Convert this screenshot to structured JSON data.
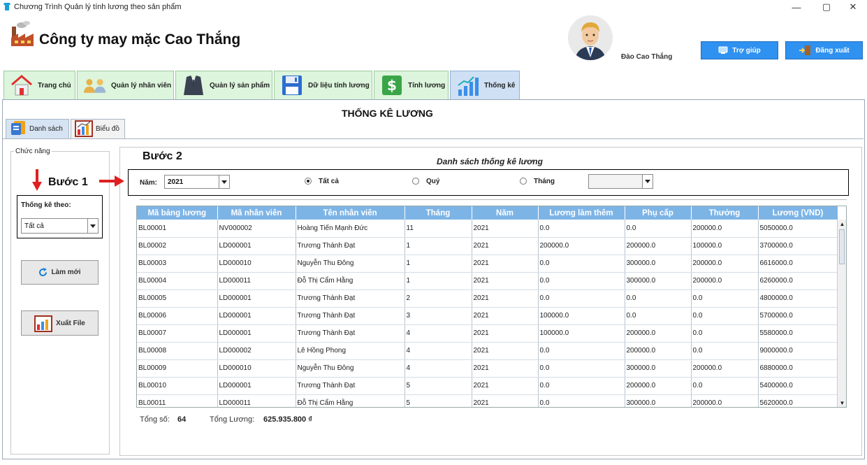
{
  "window": {
    "title": "Chương Trình Quản lý tính lương theo sản phẩm",
    "minimize_glyph": "—",
    "maximize_glyph": "▢",
    "close_glyph": "✕"
  },
  "header": {
    "company_name": "Công ty may mặc Cao Thắng",
    "user_name": "Đào Cao Thắng",
    "help_label": "Trợ giúp",
    "logout_label": "Đăng xuất"
  },
  "tabs": [
    {
      "label": "Trang chủ",
      "icon": "house-icon"
    },
    {
      "label": "Quản lý nhân viên",
      "icon": "people-icon"
    },
    {
      "label": "Quản lý sản phẩm",
      "icon": "suit-icon"
    },
    {
      "label": "Dữ liệu tính lương",
      "icon": "floppy-icon"
    },
    {
      "label": "Tính lương",
      "icon": "dollar-icon"
    },
    {
      "label": "Thống kê",
      "icon": "bar-chart-icon"
    }
  ],
  "page_title": "THỐNG KÊ LƯƠNG",
  "subtabs": [
    {
      "label": "Danh sách",
      "icon": "document-icon"
    },
    {
      "label": "Biểu đồ",
      "icon": "chart-icon"
    }
  ],
  "function_panel": {
    "title": "Chức năng",
    "step_label": "Bước 1",
    "stat_by_label": "Thống kê theo:",
    "stat_by_value": "Tất cả",
    "refresh_label": "Làm mới",
    "export_label": "Xuất File"
  },
  "list": {
    "step_label": "Bước 2",
    "title": "Danh sách thống kê lương",
    "year_label": "Năm:",
    "year_value": "2021",
    "radio_all": "Tất cả",
    "radio_quarter": "Quý",
    "radio_month": "Tháng",
    "month_value": ""
  },
  "table": {
    "columns": [
      "Mã bảng lương",
      "Mã nhân viên",
      "Tên nhân viên",
      "Tháng",
      "Năm",
      "Lương làm thêm",
      "Phụ cấp",
      "Thưởng",
      "Lương (VND)"
    ],
    "rows": [
      [
        "BL00001",
        "NV000002",
        "Hoàng Tiến Mạnh Đức",
        "11",
        "2021",
        "0.0",
        "0.0",
        "200000.0",
        "5050000.0"
      ],
      [
        "BL00002",
        "LD000001",
        "Trương Thành Đạt",
        "1",
        "2021",
        "200000.0",
        "200000.0",
        "100000.0",
        "3700000.0"
      ],
      [
        "BL00003",
        "LD000010",
        "Nguyễn Thu Đông",
        "1",
        "2021",
        "0.0",
        "300000.0",
        "200000.0",
        "6616000.0"
      ],
      [
        "BL00004",
        "LD000011",
        "Đỗ Thị Cẩm Hằng",
        "1",
        "2021",
        "0.0",
        "300000.0",
        "200000.0",
        "6260000.0"
      ],
      [
        "BL00005",
        "LD000001",
        "Trương Thành Đạt",
        "2",
        "2021",
        "0.0",
        "0.0",
        "0.0",
        "4800000.0"
      ],
      [
        "BL00006",
        "LD000001",
        "Trương Thành Đạt",
        "3",
        "2021",
        "100000.0",
        "0.0",
        "0.0",
        "5700000.0"
      ],
      [
        "BL00007",
        "LD000001",
        "Trương Thành Đạt",
        "4",
        "2021",
        "100000.0",
        "200000.0",
        "0.0",
        "5580000.0"
      ],
      [
        "BL00008",
        "LD000002",
        "Lê Hồng Phong",
        "4",
        "2021",
        "0.0",
        "200000.0",
        "0.0",
        "9000000.0"
      ],
      [
        "BL00009",
        "LD000010",
        "Nguyễn Thu Đông",
        "4",
        "2021",
        "0.0",
        "300000.0",
        "200000.0",
        "6880000.0"
      ],
      [
        "BL00010",
        "LD000001",
        "Trương Thành Đạt",
        "5",
        "2021",
        "0.0",
        "200000.0",
        "0.0",
        "5400000.0"
      ],
      [
        "BL00011",
        "LD000011",
        "Đỗ Thị Cẩm Hằng",
        "5",
        "2021",
        "0.0",
        "300000.0",
        "200000.0",
        "5620000.0"
      ]
    ]
  },
  "summary": {
    "total_count_label": "Tổng số:",
    "total_count": "64",
    "total_salary_label": "Tổng Lương:",
    "total_salary": "625.935.800 ₫"
  },
  "colors": {
    "tab_bg": "#dcf5dc",
    "tab_active_bg": "#cfe0f4",
    "table_header": "#7db4e6",
    "header_button": "#2f91f0",
    "arrow_red": "#e02020"
  }
}
